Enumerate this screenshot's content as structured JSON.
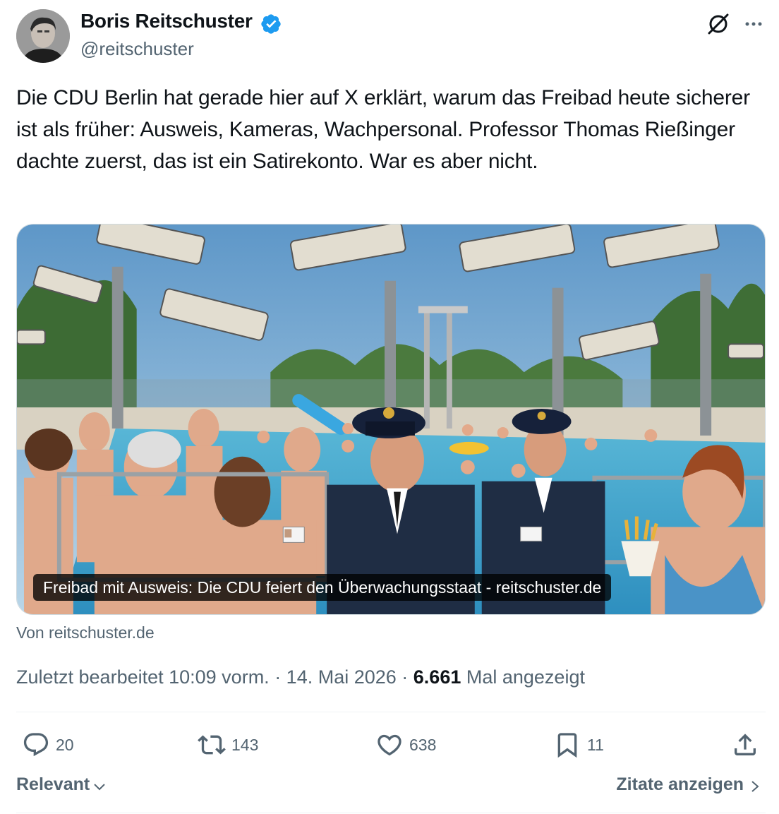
{
  "author": {
    "name": "Boris Reitschuster",
    "handle": "@reitschuster",
    "verified": true,
    "verified_color": "#1d9bf0"
  },
  "icons": {
    "verified": "verified-badge-icon",
    "grok": "grok-icon",
    "more": "more-options-icon",
    "reply": "reply-icon",
    "retweet": "retweet-icon",
    "like": "like-icon",
    "bookmark": "bookmark-icon",
    "share": "share-icon",
    "chevron": "chevron-down-icon",
    "chevron_right": "chevron-right-icon"
  },
  "tweet": {
    "text": "Die CDU Berlin hat gerade hier auf X erklärt, warum das Freibad heute sicherer ist als früher: Ausweis, Kameras, Wachpersonal. Professor Thomas Rießinger dachte zuerst, das ist ein Satirekonto. War es aber nicht.",
    "media_caption": "Freibad mit Ausweis: Die CDU feiert den Überwachungsstaat - reitschuster.de",
    "source": "Von reitschuster.de"
  },
  "meta": {
    "edited_label": "Zuletzt bearbeitet 10:09 vorm. · 14. Mai 2026 · ",
    "views_count": "6.661",
    "views_label": " Mal angezeigt"
  },
  "actions": {
    "replies": "20",
    "retweets": "143",
    "likes": "638",
    "bookmarks": "11"
  },
  "footer": {
    "sort_label": "Relevant",
    "quotes_label": "Zitate anzeigen"
  },
  "colors": {
    "text_primary": "#0f1419",
    "text_secondary": "#536471",
    "divider": "#eff3f4"
  }
}
